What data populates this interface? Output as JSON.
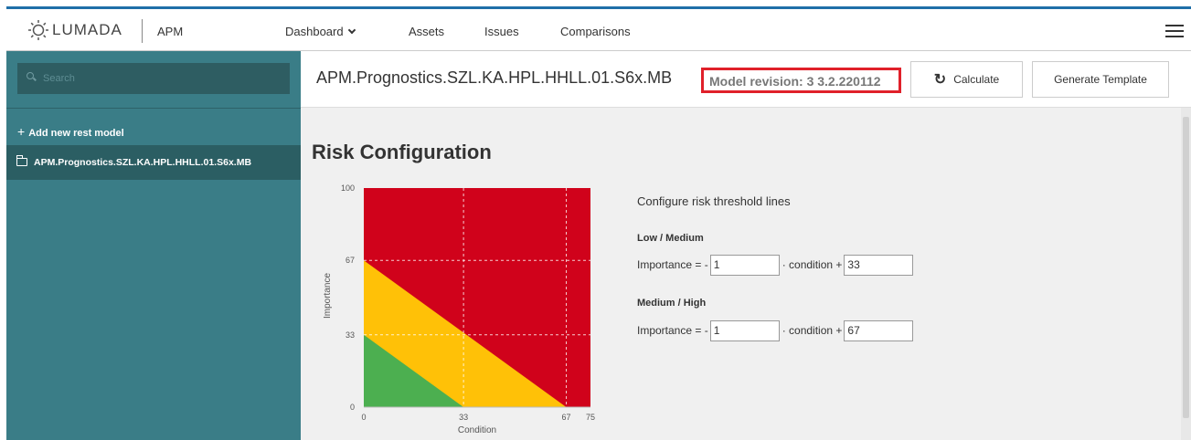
{
  "topbar": {
    "logo_text": "LUMADA",
    "app_name": "APM",
    "nav": [
      {
        "label": "Dashboard",
        "has_dropdown": true
      },
      {
        "label": "Assets"
      },
      {
        "label": "Issues"
      },
      {
        "label": "Comparisons"
      }
    ],
    "accent_color": "#1f6fa8"
  },
  "sidebar": {
    "search_placeholder": "Search",
    "add_label": "Add new rest model",
    "items": [
      {
        "label": "APM.Prognostics.SZL.KA.HPL.HHLL.01.S6x.MB",
        "selected": true
      }
    ],
    "bg_color": "#3a7d87"
  },
  "main": {
    "model_title": "APM.Prognostics.SZL.KA.HPL.HHLL.01.S6x.MB",
    "revision": "Model revision: 3 3.2.220112",
    "calculate_label": "Calculate",
    "generate_label": "Generate Template",
    "section_title": "Risk Configuration"
  },
  "chart": {
    "ylabel": "Importance",
    "xlabel": "Condition",
    "xlim": [
      0,
      75
    ],
    "ylim": [
      0,
      100
    ],
    "x_ticks": [
      "0",
      "33",
      "67",
      "75"
    ],
    "y_ticks": [
      "0",
      "33",
      "67",
      "100"
    ],
    "colors": {
      "low": "#4caf50",
      "medium": "#ffc107",
      "high": "#d0021b"
    }
  },
  "chart_data": {
    "type": "area",
    "title": "",
    "xlabel": "Condition",
    "ylabel": "Importance",
    "xlim": [
      0,
      75
    ],
    "ylim": [
      0,
      100
    ],
    "threshold_lines": [
      {
        "name": "Low / Medium",
        "slope": -1,
        "intercept": 33
      },
      {
        "name": "Medium / High",
        "slope": -1,
        "intercept": 67
      }
    ],
    "regions": [
      "low",
      "medium",
      "high"
    ],
    "grid": true
  },
  "config": {
    "heading": "Configure risk threshold lines",
    "low_medium": {
      "label": "Low / Medium",
      "prefix": "Importance = -",
      "slope": "1",
      "mid": "· condition +",
      "intercept": "33"
    },
    "medium_high": {
      "label": "Medium / High",
      "prefix": "Importance = -",
      "slope": "1",
      "mid": "· condition +",
      "intercept": "67"
    }
  }
}
